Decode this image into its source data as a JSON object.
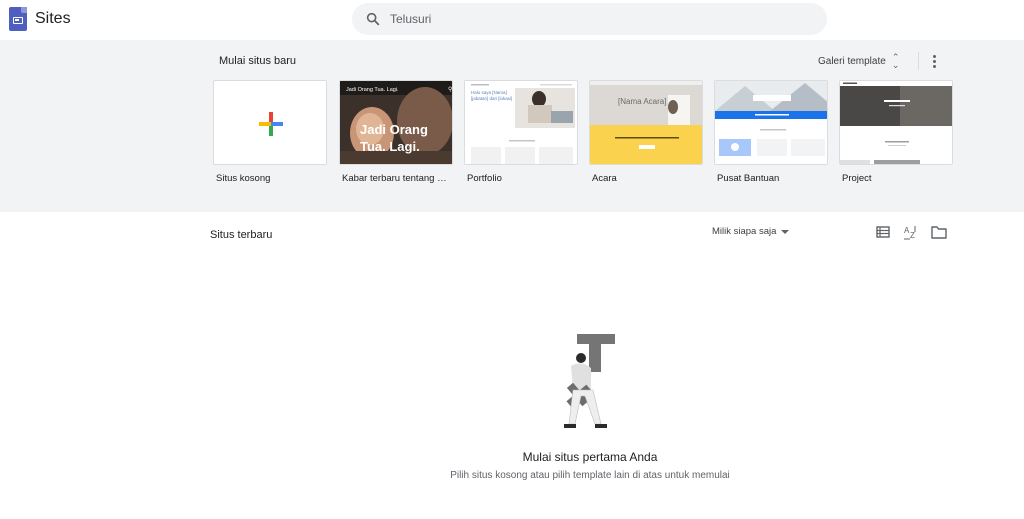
{
  "app": {
    "title": "Sites"
  },
  "search": {
    "placeholder": "Telusuri"
  },
  "templates": {
    "section_title": "Mulai situs baru",
    "gallery_label": "Galeri template",
    "cards": [
      {
        "label": "Situs kosong"
      },
      {
        "label": "Kabar terbaru tentang …",
        "header_text": "Jadi Orang Tua. Lagi.",
        "hero_text": "Jadi Orang Tua. Lagi."
      },
      {
        "label": "Portfolio",
        "hero_text": "Halo saya [Nama] [jabatan] dari [lokasi]"
      },
      {
        "label": "Acara",
        "hero_text": "[Nama Acara]"
      },
      {
        "label": "Pusat Bantuan"
      },
      {
        "label": "Project"
      }
    ]
  },
  "recent": {
    "section_title": "Situs terbaru",
    "owner_filter": "Milik siapa saja"
  },
  "empty_state": {
    "title": "Mulai situs pertama Anda",
    "subtitle": "Pilih situs kosong atau pilih template lain di atas untuk memulai"
  },
  "colors": {
    "brand": "#4e5fbf",
    "event_yellow": "#fbd24e",
    "help_blue": "#1a73e8"
  }
}
